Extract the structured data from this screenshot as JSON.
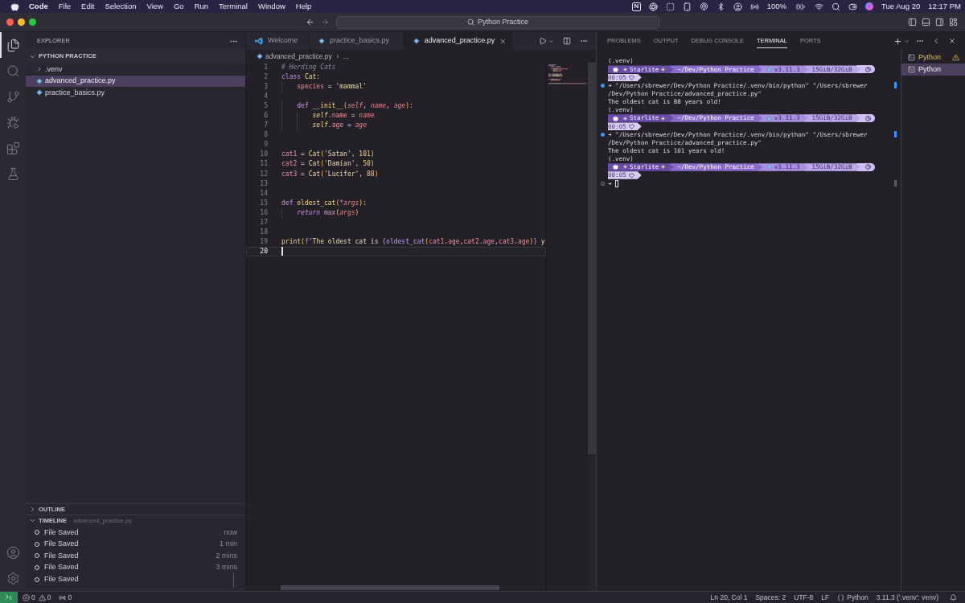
{
  "menubar": {
    "app": "Code",
    "menus": [
      "File",
      "Edit",
      "Selection",
      "View",
      "Go",
      "Run",
      "Terminal",
      "Window",
      "Help"
    ],
    "badge": "N",
    "battery": "100%",
    "date": "Tue Aug 20",
    "time": "12:17 PM"
  },
  "titlebar": {
    "search": "Python Practice"
  },
  "activity_bar": {
    "items": [
      {
        "kind": "explorer",
        "selected": true
      },
      {
        "kind": "search",
        "selected": false
      },
      {
        "kind": "source-control",
        "selected": false
      },
      {
        "kind": "run-debug",
        "selected": false
      },
      {
        "kind": "extensions",
        "selected": false
      },
      {
        "kind": "testing",
        "selected": false
      }
    ],
    "bottom": [
      {
        "kind": "account"
      },
      {
        "kind": "settings"
      }
    ]
  },
  "sidebar": {
    "title": "EXPLORER",
    "folder": {
      "name": "PYTHON PRACTICE",
      "expanded": true,
      "children": [
        {
          "name": ".venv",
          "kind": "folder",
          "expanded": false,
          "selected": false
        },
        {
          "name": "advanced_practice.py",
          "kind": "python",
          "selected": true
        },
        {
          "name": "practice_basics.py",
          "kind": "python",
          "selected": false
        }
      ]
    },
    "outline": {
      "title": "OUTLINE",
      "expanded": false
    },
    "timeline": {
      "title": "TIMELINE",
      "subtitle": "advanced_practice.py",
      "expanded": true,
      "entries": [
        {
          "label": "File Saved",
          "time": "now"
        },
        {
          "label": "File Saved",
          "time": "1 min"
        },
        {
          "label": "File Saved",
          "time": "2 mins"
        },
        {
          "label": "File Saved",
          "time": "3 mins"
        },
        {
          "label": "File Saved"
        }
      ]
    }
  },
  "editor": {
    "tabs": [
      {
        "label": "Welcome",
        "kind": "welcome",
        "selected": false
      },
      {
        "label": "practice_basics.py",
        "kind": "python",
        "selected": false
      },
      {
        "label": "advanced_practice.py",
        "kind": "python",
        "selected": true
      }
    ],
    "breadcrumb": [
      "advanced_practice.py",
      "..."
    ],
    "lines": [
      {
        "number": "1",
        "current": false,
        "tokens": [
          {
            "kind": "comment",
            "text": "# Herding Cats"
          }
        ]
      },
      {
        "number": "2",
        "current": false,
        "tokens": [
          {
            "kind": "keyword",
            "text": "class "
          },
          {
            "kind": "class",
            "text": "Cat"
          },
          {
            "kind": "plain",
            "text": ":"
          }
        ]
      },
      {
        "number": "3",
        "current": false,
        "tokens": [
          {
            "kind": "variable",
            "text": "    species"
          },
          {
            "kind": "plain",
            "text": " = "
          },
          {
            "kind": "string",
            "text": "'mammal'"
          }
        ]
      },
      {
        "number": "4",
        "current": false
      },
      {
        "number": "5",
        "current": false,
        "tokens": [
          {
            "kind": "keyword",
            "text": "    def "
          },
          {
            "kind": "function",
            "text": "__init__"
          },
          {
            "kind": "bracket",
            "text": "("
          },
          {
            "kind": "param",
            "text": "self"
          },
          {
            "kind": "plain",
            "text": ", "
          },
          {
            "kind": "param",
            "text": "name"
          },
          {
            "kind": "plain",
            "text": ", "
          },
          {
            "kind": "param",
            "text": "age"
          },
          {
            "kind": "bracket",
            "text": ")"
          },
          {
            "kind": "plain",
            "text": ":"
          }
        ]
      },
      {
        "number": "6",
        "current": false,
        "tokens": [
          {
            "kind": "self",
            "text": "        self"
          },
          {
            "kind": "plain",
            "text": "."
          },
          {
            "kind": "property",
            "text": "name"
          },
          {
            "kind": "plain",
            "text": " = "
          },
          {
            "kind": "param",
            "text": "name"
          }
        ]
      },
      {
        "number": "7",
        "current": false,
        "tokens": [
          {
            "kind": "self",
            "text": "        self"
          },
          {
            "kind": "plain",
            "text": "."
          },
          {
            "kind": "property",
            "text": "age"
          },
          {
            "kind": "plain",
            "text": " = "
          },
          {
            "kind": "param",
            "text": "age"
          }
        ]
      },
      {
        "number": "8",
        "current": false
      },
      {
        "number": "9",
        "current": false
      },
      {
        "number": "10",
        "current": false,
        "tokens": [
          {
            "kind": "variable",
            "text": "cat1"
          },
          {
            "kind": "plain",
            "text": " = "
          },
          {
            "kind": "class",
            "text": "Cat"
          },
          {
            "kind": "bracket",
            "text": "("
          },
          {
            "kind": "string",
            "text": "'Satan'"
          },
          {
            "kind": "plain",
            "text": ", "
          },
          {
            "kind": "number",
            "text": "101"
          },
          {
            "kind": "bracket",
            "text": ")"
          }
        ]
      },
      {
        "number": "11",
        "current": false,
        "tokens": [
          {
            "kind": "variable",
            "text": "cat2"
          },
          {
            "kind": "plain",
            "text": " = "
          },
          {
            "kind": "class",
            "text": "Cat"
          },
          {
            "kind": "bracket",
            "text": "("
          },
          {
            "kind": "string",
            "text": "'Damian'"
          },
          {
            "kind": "plain",
            "text": ", "
          },
          {
            "kind": "number",
            "text": "50"
          },
          {
            "kind": "bracket",
            "text": ")"
          }
        ]
      },
      {
        "number": "12",
        "current": false,
        "tokens": [
          {
            "kind": "variable",
            "text": "cat3"
          },
          {
            "kind": "plain",
            "text": " = "
          },
          {
            "kind": "class",
            "text": "Cat"
          },
          {
            "kind": "bracket",
            "text": "("
          },
          {
            "kind": "string",
            "text": "'Lucifer'"
          },
          {
            "kind": "plain",
            "text": ", "
          },
          {
            "kind": "number",
            "text": "88"
          },
          {
            "kind": "bracket",
            "text": ")"
          }
        ]
      },
      {
        "number": "13",
        "current": false
      },
      {
        "number": "14",
        "current": false
      },
      {
        "number": "15",
        "current": false,
        "tokens": [
          {
            "kind": "keyword",
            "text": "def "
          },
          {
            "kind": "function",
            "text": "oldest_cat"
          },
          {
            "kind": "bracket",
            "text": "("
          },
          {
            "kind": "operator",
            "text": "*"
          },
          {
            "kind": "param",
            "text": "args"
          },
          {
            "kind": "bracket",
            "text": ")"
          },
          {
            "kind": "plain",
            "text": ":"
          }
        ]
      },
      {
        "number": "16",
        "current": false,
        "tokens": [
          {
            "kind": "control",
            "text": "    return "
          },
          {
            "kind": "builtin",
            "text": "max"
          },
          {
            "kind": "bracket",
            "text": "("
          },
          {
            "kind": "param",
            "text": "args"
          },
          {
            "kind": "bracket",
            "text": ")"
          }
        ]
      },
      {
        "number": "17",
        "current": false
      },
      {
        "number": "18",
        "current": false
      },
      {
        "number": "19",
        "current": false,
        "tokens": [
          {
            "kind": "function",
            "text": "print"
          },
          {
            "kind": "bracket",
            "text": "("
          },
          {
            "kind": "keyword",
            "text": "f"
          },
          {
            "kind": "string",
            "text": "'The oldest cat is "
          },
          {
            "kind": "interp",
            "text": "{"
          },
          {
            "kind": "interp",
            "text": "oldest_cat"
          },
          {
            "kind": "bracket",
            "text": "("
          },
          {
            "kind": "variable",
            "text": "cat1"
          },
          {
            "kind": "plain",
            "text": "."
          },
          {
            "kind": "property",
            "text": "age"
          },
          {
            "kind": "plain",
            "text": ","
          },
          {
            "kind": "variable",
            "text": "cat2"
          },
          {
            "kind": "plain",
            "text": "."
          },
          {
            "kind": "property",
            "text": "age"
          },
          {
            "kind": "plain",
            "text": ","
          },
          {
            "kind": "variable",
            "text": "cat3"
          },
          {
            "kind": "plain",
            "text": "."
          },
          {
            "kind": "property",
            "text": "age"
          },
          {
            "kind": "bracket",
            "text": ")"
          },
          {
            "kind": "interp",
            "text": "}"
          },
          {
            "kind": "string",
            "text": " y"
          }
        ]
      },
      {
        "number": "20",
        "current": true
      }
    ]
  },
  "panel": {
    "tabs": [
      {
        "label": "PROBLEMS",
        "selected": false
      },
      {
        "label": "OUTPUT",
        "selected": false
      },
      {
        "label": "DEBUG CONSOLE",
        "selected": false
      },
      {
        "label": "TERMINAL",
        "selected": true
      },
      {
        "label": "PORTS",
        "selected": false
      }
    ],
    "terminal": [
      {
        "kind": "text",
        "text": "(.venv)"
      },
      {
        "kind": "prompt",
        "user": "Starlite",
        "path": "~/Dev/Python Practice",
        "version": "v3.11.3",
        "memory": "15GiB/32GiB",
        "duration": "00:05"
      },
      {
        "kind": "command",
        "done": true,
        "cursor": false,
        "text": "➜ \"/Users/sbrewer/Dev/Python Practice/.venv/bin/python\" \"/Users/sbrewer"
      },
      {
        "kind": "text",
        "text": "/Dev/Python Practice/advanced_practice.py\""
      },
      {
        "kind": "text",
        "text": "The oldest cat is 88 years old!"
      },
      {
        "kind": "text",
        "text": "(.venv)"
      },
      {
        "kind": "prompt",
        "user": "Starlite",
        "path": "~/Dev/Python Practice",
        "version": "v3.11.3",
        "memory": "15GiB/32GiB",
        "duration": "00:05"
      },
      {
        "kind": "command",
        "done": true,
        "cursor": false,
        "text": "➜ \"/Users/sbrewer/Dev/Python Practice/.venv/bin/python\" \"/Users/sbrewer"
      },
      {
        "kind": "text",
        "text": "/Dev/Python Practice/advanced_practice.py\""
      },
      {
        "kind": "text",
        "text": "The oldest cat is 101 years old!"
      },
      {
        "kind": "text",
        "text": "(.venv)"
      },
      {
        "kind": "prompt",
        "user": "Starlite",
        "path": "~/Dev/Python Practice",
        "version": "v3.11.3",
        "memory": "15GiB/32GiB",
        "duration": "00:05"
      },
      {
        "kind": "command",
        "done": false,
        "cursor": true,
        "text": "➜"
      }
    ],
    "sessions": [
      {
        "label": "Python",
        "warning": true,
        "selected": false
      },
      {
        "label": "Python",
        "warning": false,
        "selected": true
      }
    ]
  },
  "status_bar": {
    "errors": "0",
    "warnings": "0",
    "ports": "0",
    "items": [
      {
        "kind": "text",
        "text": "Ln 20, Col 1"
      },
      {
        "kind": "text",
        "text": "Spaces: 2"
      },
      {
        "kind": "text",
        "text": "UTF-8"
      },
      {
        "kind": "text",
        "text": "LF"
      },
      {
        "kind": "language",
        "text": "Python"
      },
      {
        "kind": "text",
        "text": "3.11.3 ('.venv': venv)"
      }
    ]
  }
}
